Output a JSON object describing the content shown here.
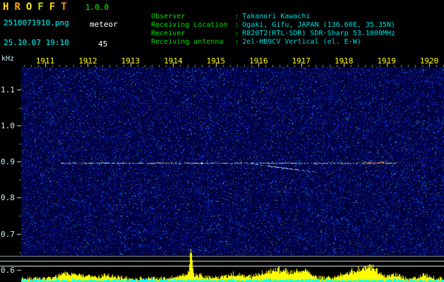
{
  "header": {
    "title_letters": [
      "H",
      "R",
      "O",
      "F",
      "F",
      "T"
    ],
    "version": "1.0.0",
    "filename": "2510071910.png",
    "mode": "meteor",
    "datetime": "25.10.07 19:10",
    "count": "45",
    "separator": ":",
    "info": [
      {
        "label": "Observer",
        "value": "Takanori Kawachi"
      },
      {
        "label": "Receiving Location",
        "value": "Ogaki, Gifu, JAPAN (136.60E, 35.35N)"
      },
      {
        "label": "Receiver",
        "value": "R820T2(RTL-SDR) SDR-Sharp 53.1000MHz"
      },
      {
        "label": "Receiving antenna",
        "value": "2el-HB9CV Vertical (el. E-W)"
      }
    ]
  },
  "spectrogram": {
    "y_unit_label": "kHz",
    "time_labels": [
      "1911",
      "1912",
      "1913",
      "1914",
      "1915",
      "1916",
      "1917",
      "1918",
      "1919",
      "1920"
    ],
    "freq_labels": [
      "1.1",
      "1.0",
      "0.9",
      "0.8",
      "0.7",
      "0.6"
    ]
  },
  "chart_data": {
    "type": "heatmap",
    "title": "HROFFT 10-minute meteor-radio spectrogram",
    "x_tick_labels": [
      "1911",
      "1912",
      "1913",
      "1914",
      "1915",
      "1916",
      "1917",
      "1918",
      "1919",
      "1920"
    ],
    "ylabel": "kHz",
    "y_tick_labels": [
      "1.1",
      "1.0",
      "0.9",
      "0.8",
      "0.7",
      "0.6"
    ],
    "y_range_khz": [
      0.55,
      1.15
    ],
    "features": [
      {
        "type": "carrier-line",
        "freq_khz": 0.9,
        "from_label": "1911",
        "to_label": "1919"
      },
      {
        "type": "drifting-trace",
        "freq_khz_start": 0.9,
        "freq_khz_end": 0.88,
        "near_label": "1916"
      },
      {
        "type": "meteor-echo",
        "freq_khz": 0.9,
        "near_label": "1918",
        "color": "red"
      },
      {
        "type": "signal-level-bars",
        "position": "bottom",
        "color": "yellow",
        "base_color": "cyan"
      }
    ]
  },
  "colors": {
    "background": "#000000",
    "noise_background": "#000038",
    "title_letter_colors": [
      "#ffdd00",
      "#ffaa00",
      "#ffee00",
      "#ccdd00",
      "#ffcc00",
      "#ff9900"
    ],
    "version_color": "#00ff00",
    "filename_color": "#00ffff",
    "mode_color": "#ffffff",
    "datetime_color": "#00ffff",
    "count_color": "#ffffff",
    "info_label_color": "#00dd00",
    "info_value_color": "#00dddd",
    "time_axis_color": "#ffff00",
    "freq_axis_color": "#c8f0f0",
    "carrier_line_color": "#aaffc8",
    "meteor_echo_color": "#ff5040",
    "reference_line_color": "#d8e8e8",
    "bar_color": "#ffff00",
    "bar_base_color": "#00ffff"
  }
}
